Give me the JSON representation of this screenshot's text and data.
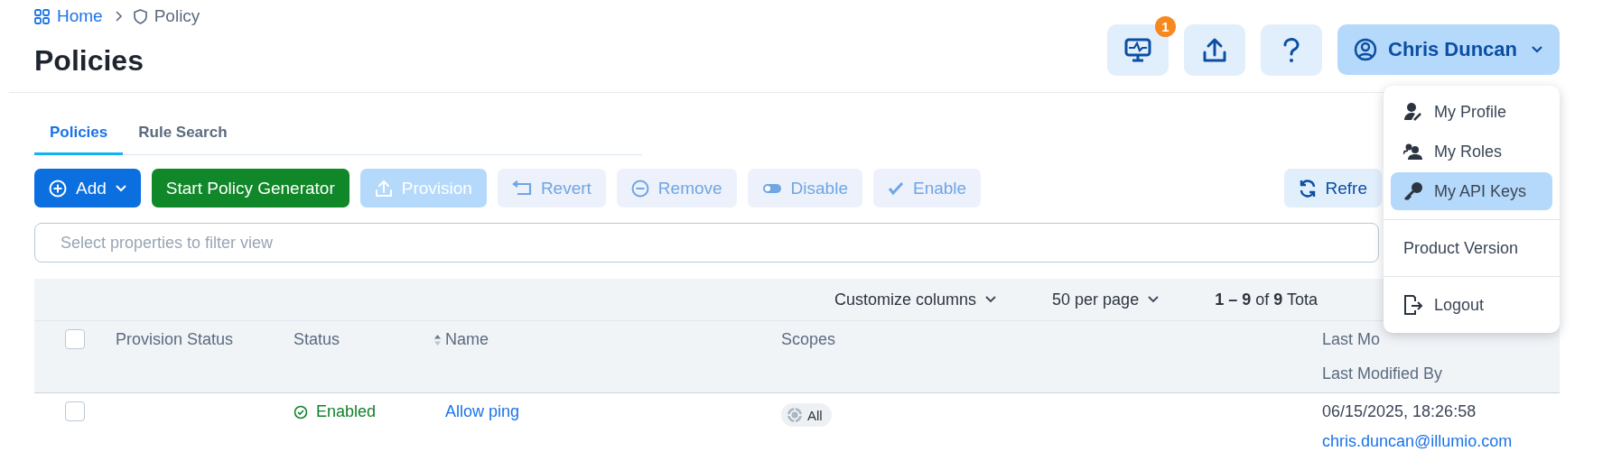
{
  "breadcrumb": [
    {
      "label": "Home",
      "kind": "home"
    },
    {
      "label": "Policy",
      "kind": "policy"
    }
  ],
  "page_title": "Policies",
  "header_actions": {
    "notifications_badge": "1",
    "user_name": "Chris Duncan"
  },
  "tabs": [
    {
      "label": "Policies",
      "selected": true
    },
    {
      "label": "Rule Search",
      "selected": false
    }
  ],
  "toolbar": [
    {
      "label": "Add",
      "kind": "add",
      "disabled": false
    },
    {
      "label": "Start Policy Generator",
      "kind": "generator",
      "disabled": false
    },
    {
      "label": "Provision",
      "kind": "provision",
      "disabled": true
    },
    {
      "label": "Revert",
      "kind": "revert",
      "disabled": true
    },
    {
      "label": "Remove",
      "kind": "remove",
      "disabled": true
    },
    {
      "label": "Disable",
      "kind": "disable",
      "disabled": true
    },
    {
      "label": "Enable",
      "kind": "enable",
      "disabled": true
    }
  ],
  "refresh_button": "Refre",
  "filter": {
    "placeholder": "Select properties to filter view"
  },
  "table_toolbar": {
    "customize": "Customize columns",
    "per_page": "50 per page",
    "range": "**1 – 9** of **9** Tota"
  },
  "columns": [
    {
      "label": "Provision Status",
      "sortable": false
    },
    {
      "label": "Status",
      "sortable": false
    },
    {
      "label": "Name",
      "sortable": true
    },
    {
      "label": "Scopes",
      "sortable": false
    },
    {
      "label": "Last Mo",
      "sub_label": "Last Modified By",
      "sortable": false
    }
  ],
  "header_checked": false,
  "rows": [
    {
      "checked": false,
      "status": "Enabled",
      "name": "Allow ping",
      "scope": "All",
      "modified_on": "06/15/2025, 18:26:58",
      "modified_by": "chris.duncan@illumio.com"
    }
  ],
  "user_menu": {
    "groups": [
      {
        "items": [
          {
            "label": "My Profile",
            "kind": "profile",
            "selected": false
          },
          {
            "label": "My Roles",
            "kind": "roles",
            "selected": false
          },
          {
            "label": "My API Keys",
            "kind": "keys",
            "selected": true
          }
        ]
      },
      {
        "items": [
          {
            "label": "Product Version",
            "kind": "version",
            "selected": false
          }
        ]
      },
      {
        "items": [
          {
            "label": "Logout",
            "kind": "logout",
            "selected": false
          }
        ]
      }
    ]
  }
}
